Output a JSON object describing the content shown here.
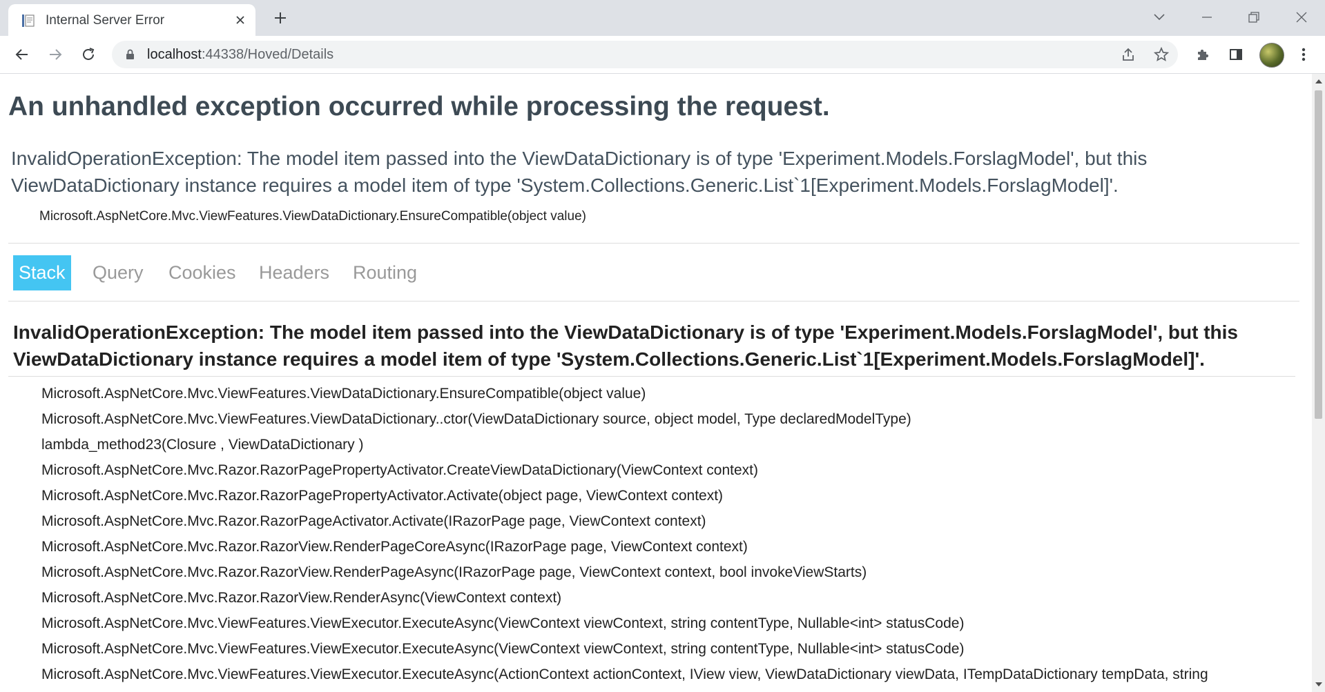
{
  "browser": {
    "tab_title": "Internal Server Error",
    "url_host": "localhost",
    "url_rest": ":44338/Hoved/Details"
  },
  "page": {
    "heading": "An unhandled exception occurred while processing the request.",
    "title_error": "InvalidOperationException: The model item passed into the ViewDataDictionary is of type 'Experiment.Models.ForslagModel', but this ViewDataDictionary instance requires a model item of type 'System.Collections.Generic.List`1[Experiment.Models.ForslagModel]'.",
    "location": "Microsoft.AspNetCore.Mvc.ViewFeatures.ViewDataDictionary.EnsureCompatible(object value)",
    "tabs": [
      "Stack",
      "Query",
      "Cookies",
      "Headers",
      "Routing"
    ],
    "selected_tab_color": "#44c5f2",
    "exception_title": "InvalidOperationException: The model item passed into the ViewDataDictionary is of type 'Experiment.Models.ForslagModel', but this ViewDataDictionary instance requires a model item of type 'System.Collections.Generic.List`1[Experiment.Models.ForslagModel]'.",
    "frames": [
      "Microsoft.AspNetCore.Mvc.ViewFeatures.ViewDataDictionary.EnsureCompatible(object value)",
      "Microsoft.AspNetCore.Mvc.ViewFeatures.ViewDataDictionary..ctor(ViewDataDictionary source, object model, Type declaredModelType)",
      "lambda_method23(Closure , ViewDataDictionary )",
      "Microsoft.AspNetCore.Mvc.Razor.RazorPagePropertyActivator.CreateViewDataDictionary(ViewContext context)",
      "Microsoft.AspNetCore.Mvc.Razor.RazorPagePropertyActivator.Activate(object page, ViewContext context)",
      "Microsoft.AspNetCore.Mvc.Razor.RazorPageActivator.Activate(IRazorPage page, ViewContext context)",
      "Microsoft.AspNetCore.Mvc.Razor.RazorView.RenderPageCoreAsync(IRazorPage page, ViewContext context)",
      "Microsoft.AspNetCore.Mvc.Razor.RazorView.RenderPageAsync(IRazorPage page, ViewContext context, bool invokeViewStarts)",
      "Microsoft.AspNetCore.Mvc.Razor.RazorView.RenderAsync(ViewContext context)",
      "Microsoft.AspNetCore.Mvc.ViewFeatures.ViewExecutor.ExecuteAsync(ViewContext viewContext, string contentType, Nullable<int> statusCode)",
      "Microsoft.AspNetCore.Mvc.ViewFeatures.ViewExecutor.ExecuteAsync(ViewContext viewContext, string contentType, Nullable<int> statusCode)",
      "Microsoft.AspNetCore.Mvc.ViewFeatures.ViewExecutor.ExecuteAsync(ActionContext actionContext, IView view, ViewDataDictionary viewData, ITempDataDictionary tempData, string"
    ]
  }
}
